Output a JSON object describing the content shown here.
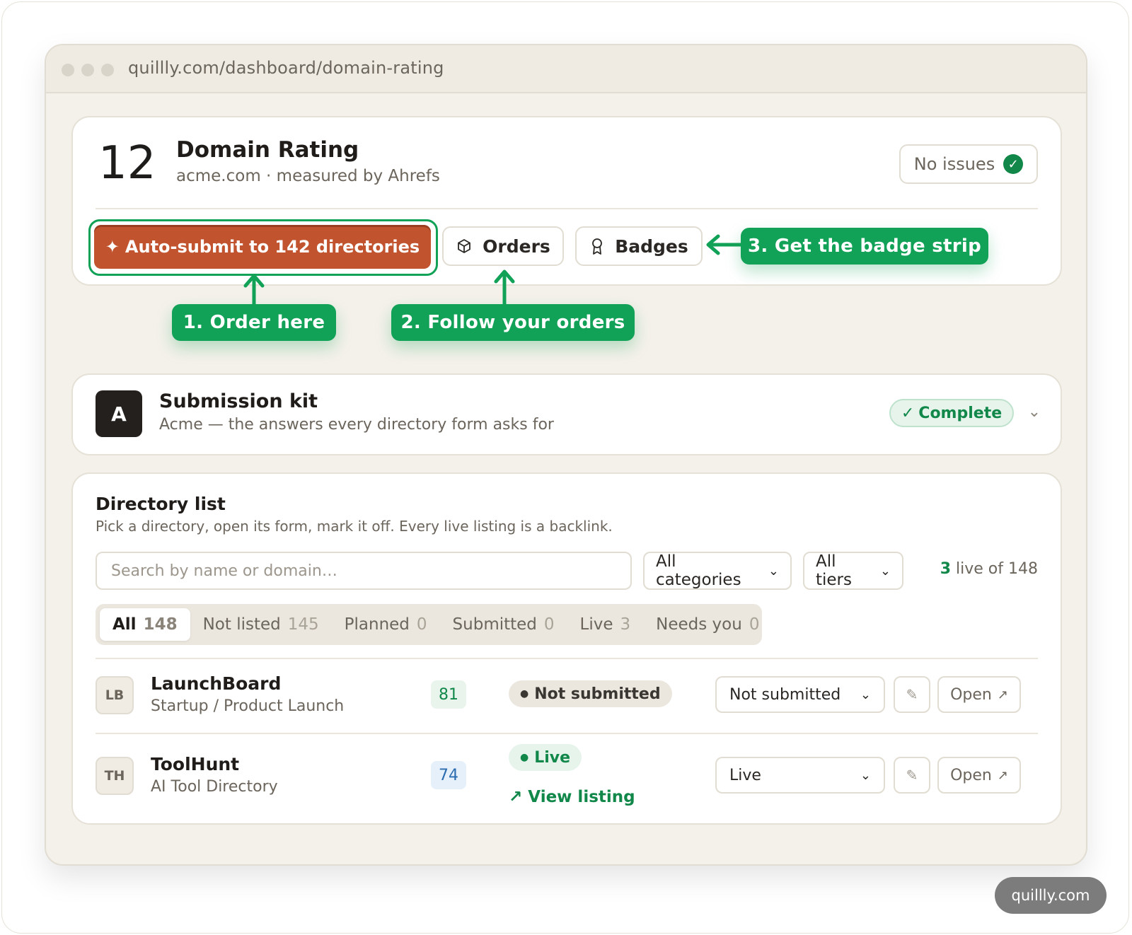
{
  "browser": {
    "url": "quillly.com/dashboard/domain-rating"
  },
  "domain_rating": {
    "value": "12",
    "title": "Domain Rating",
    "subtitle": "acme.com · measured by Ahrefs",
    "status_label": "No issues",
    "status_icon": "check-circle-icon",
    "auto_submit_label": "Auto-submit to 142 directories",
    "auto_submit_icon": "✦",
    "orders_label": "Orders",
    "badges_label": "Badges"
  },
  "annotations": {
    "step1": "1. Order here",
    "step2": "2. Follow your orders",
    "step3": "3. Get the badge strip",
    "color": "#11a157"
  },
  "submission_kit": {
    "avatar": "A",
    "title": "Submission kit",
    "subtitle": "Acme — the answers every directory form asks for",
    "status": "Complete",
    "status_icon": "✓"
  },
  "directory_list": {
    "title": "Directory list",
    "subtitle": "Pick a directory, open its form, mark it off. Every live listing is a backlink.",
    "search_placeholder": "Search by name or domain…",
    "category_filter": "All categories",
    "tier_filter": "All tiers",
    "live_count": "3",
    "live_of": "live of 148",
    "tabs": [
      {
        "label": "All",
        "count": "148",
        "active": true
      },
      {
        "label": "Not listed",
        "count": "145"
      },
      {
        "label": "Planned",
        "count": "0"
      },
      {
        "label": "Submitted",
        "count": "0"
      },
      {
        "label": "Live",
        "count": "3"
      },
      {
        "label": "Needs you",
        "count": "0"
      }
    ],
    "rows": [
      {
        "initials": "LB",
        "name": "LaunchBoard",
        "category": "Startup / Product Launch",
        "score": "81",
        "status": "Not submitted",
        "select_value": "Not submitted",
        "open_label": "Open"
      },
      {
        "initials": "TH",
        "name": "ToolHunt",
        "category": "AI Tool Directory",
        "score": "74",
        "status": "Live",
        "view_link": "View listing",
        "select_value": "Live",
        "open_label": "Open"
      }
    ]
  },
  "watermark": "quillly.com",
  "colors": {
    "accent_orange": "#c1532e",
    "green": "#11a157",
    "background": "#f4f1ea"
  }
}
